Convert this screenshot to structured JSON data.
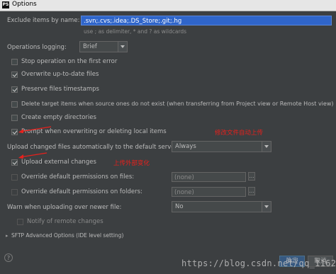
{
  "window": {
    "title": "Options",
    "app_icon_text": "PS"
  },
  "exclude": {
    "label": "Exclude items by name:",
    "value": ".svn;.cvs;.idea;.DS_Store;.git;.hg",
    "hint": "use ; as delimiter, * and ? as wildcards"
  },
  "logging": {
    "label": "Operations logging:",
    "value": "Brief"
  },
  "checkboxes": [
    {
      "label": "Stop operation on the first error",
      "checked": false
    },
    {
      "label": "Overwrite up-to-date files",
      "checked": true
    },
    {
      "label": "Preserve files timestamps",
      "checked": true
    },
    {
      "label": "Delete target items when source ones do not exist (when transferring from Project view or Remote Host view)",
      "checked": false
    },
    {
      "label": "Create empty directories",
      "checked": false
    },
    {
      "label": "Prompt when overwriting or deleting local items",
      "checked": true
    }
  ],
  "upload_changed": {
    "label": "Upload changed files automatically to the default server",
    "value": "Always"
  },
  "upload_external": {
    "label": "Upload external changes",
    "checked": true
  },
  "override_files": {
    "label": "Override default permissions on files:",
    "value": "(none)",
    "checked": false
  },
  "override_folders": {
    "label": "Override default permissions on folders:",
    "value": "(none)",
    "checked": false
  },
  "warn_newer": {
    "label": "Warn when uploading over newer file:",
    "value": "No"
  },
  "notify_remote": {
    "label": "Notify of remote changes",
    "checked": false
  },
  "sftp": {
    "label": "SFTP Advanced Options (IDE level setting)"
  },
  "annotations": {
    "prompt_note": "修改文件自动上传",
    "external_note": "上传外部变化"
  },
  "buttons": {
    "ok": "确定",
    "cancel": "取消"
  },
  "watermark": "https://blog.csdn.net/qq_1162002"
}
